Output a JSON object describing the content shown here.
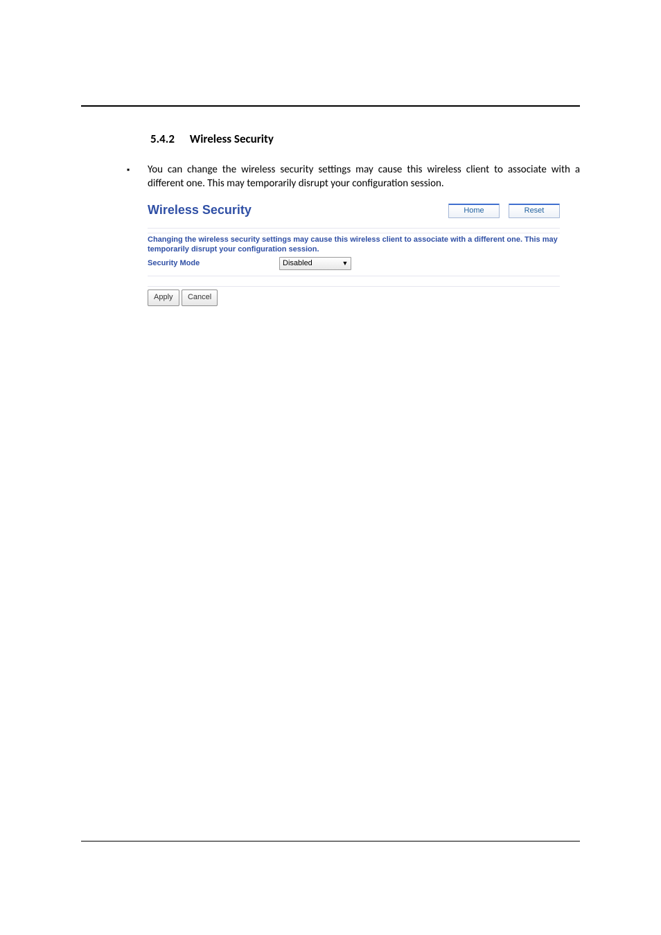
{
  "section": {
    "number": "5.4.2",
    "title": "Wireless Security"
  },
  "bullet": {
    "char": "▪",
    "text": "You can change the wireless security settings may cause this wireless client to associate with a different one. This may temporarily disrupt your configuration session."
  },
  "screenshot": {
    "title": "Wireless Security",
    "home_label": "Home",
    "reset_label": "Reset",
    "message": "Changing the wireless security settings may cause this wireless client to associate with a different one. This may temporarily disrupt your configuration session.",
    "mode_label": "Security Mode",
    "mode_value": "Disabled",
    "apply_label": "Apply",
    "cancel_label": "Cancel"
  }
}
